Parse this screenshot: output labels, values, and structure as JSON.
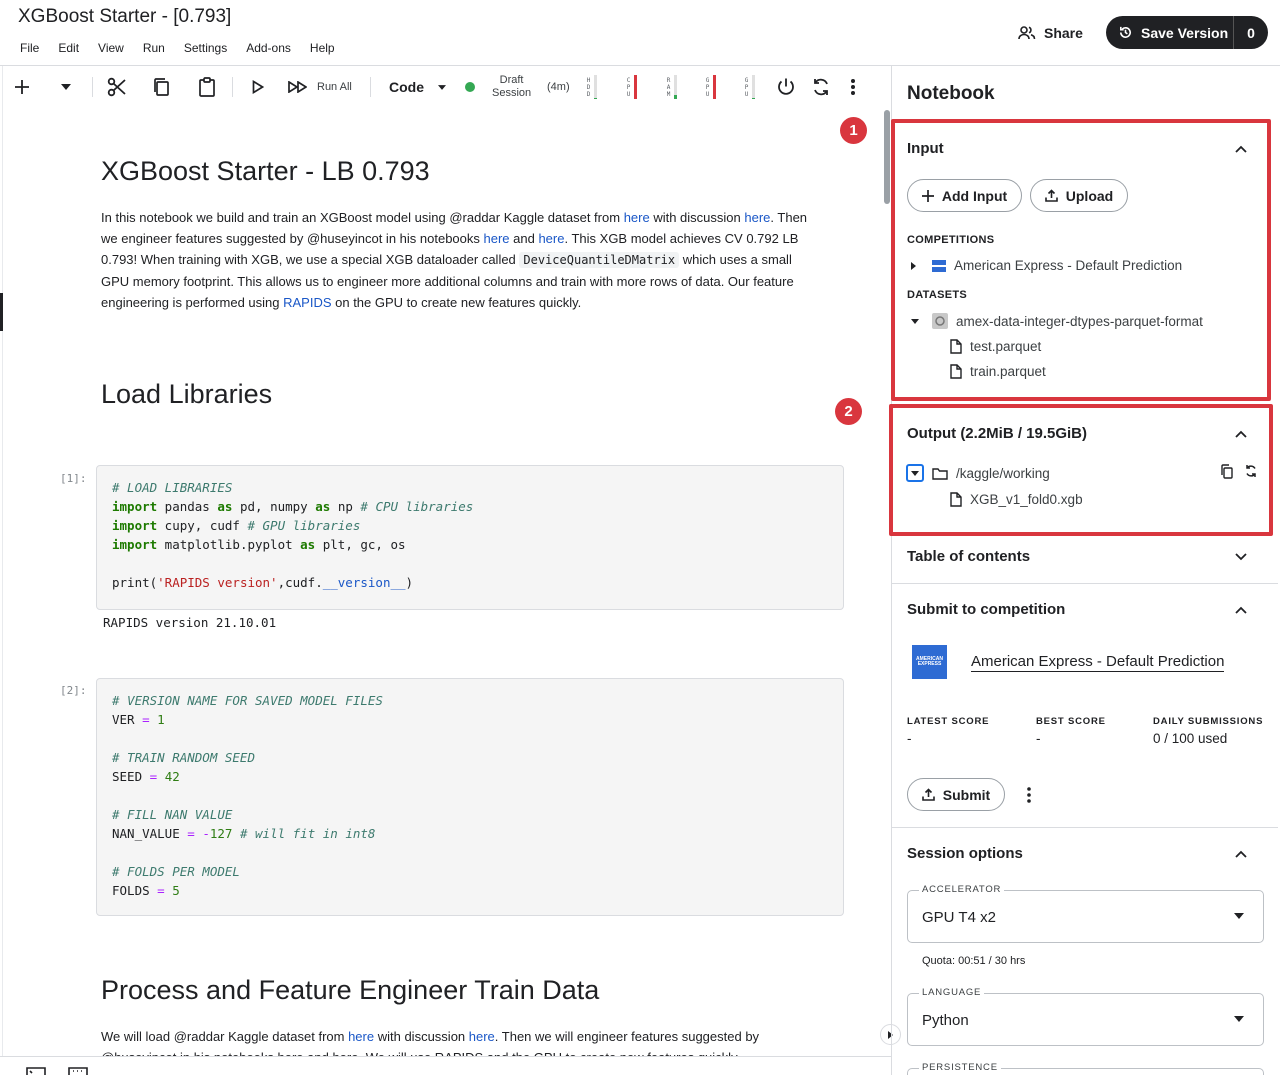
{
  "header": {
    "title": "XGBoost Starter - [0.793]",
    "menu": [
      "File",
      "Edit",
      "View",
      "Run",
      "Settings",
      "Add-ons",
      "Help"
    ],
    "share_label": "Share",
    "save_label": "Save Version",
    "save_count": "0"
  },
  "toolbar": {
    "run_all_label": "Run All",
    "cell_type": "Code",
    "session_line1": "Draft",
    "session_line2": "Session",
    "session_time": "(4m)",
    "session_status_color": "#34a853",
    "meters": [
      {
        "label": [
          "H",
          "D",
          "D"
        ],
        "fill": 0.05,
        "color": "#34a853"
      },
      {
        "label": [
          "C",
          "P",
          "U"
        ],
        "fill": 1.0,
        "color": "#d9363e"
      },
      {
        "label": [
          "R",
          "A",
          "M"
        ],
        "fill": 0.15,
        "color": "#34a853"
      },
      {
        "label": [
          "G",
          "P",
          "U"
        ],
        "fill": 1.0,
        "color": "#d9363e"
      },
      {
        "label": [
          "G",
          "P",
          "U"
        ],
        "fill": 0.05,
        "color": "#34a853"
      }
    ]
  },
  "notebook": {
    "h1_title": "XGBoost Starter - LB 0.793",
    "intro": {
      "t1": "In this notebook we build and train an XGBoost model using @raddar Kaggle dataset from ",
      "l1": "here",
      "t2": " with discussion ",
      "l2": "here",
      "t3": ". Then we engineer features suggested by @huseyincot in his notebooks ",
      "l3": "here",
      "t4": " and ",
      "l4": "here",
      "t5": ". This XGB model achieves CV 0.792 LB 0.793! When training with XGB, we use a special XGB dataloader called ",
      "code": "DeviceQuantileDMatrix",
      "t6": " which uses a small GPU memory footprint. This allows us to engineer more additional columns and train with more rows of data. Our feature engineering is performed using ",
      "l5": "RAPIDS",
      "t7": " on the GPU to create new features quickly."
    },
    "h1_load": "Load Libraries",
    "prompt1": "[1]:",
    "cell1": {
      "c1": "# LOAD LIBRARIES",
      "k1": "import",
      "m1": " pandas ",
      "k2": "as",
      "m2": " pd, numpy ",
      "k3": "as",
      "m3": " np ",
      "c2": "# CPU libraries",
      "k4": "import",
      "m4": " cupy, cudf ",
      "c3": "# GPU libraries",
      "k5": "import",
      "m5": " matplotlib.pyplot ",
      "k6": "as",
      "m6": " plt, gc, os",
      "p1": "print(",
      "s1": "'RAPIDS version'",
      "p2": ",cudf.",
      "a1": "__version__",
      "p3": ")"
    },
    "output1": "RAPIDS version 21.10.01",
    "prompt2": "[2]:",
    "cell2": {
      "c1": "# VERSION NAME FOR SAVED MODEL FILES",
      "v1": "VER ",
      "o1": "=",
      "n1": " 1",
      "c2": "# TRAIN RANDOM SEED",
      "v2": "SEED ",
      "o2": "=",
      "n2": " 42",
      "c3": "# FILL NAN VALUE",
      "v3": "NAN_VALUE ",
      "o3": "=",
      "n3a": " ",
      "o3b": "-",
      "n3": "127",
      "c4": " # will fit in int8",
      "c5": "# FOLDS PER MODEL",
      "v5": "FOLDS ",
      "o5": "=",
      "n5": " 5"
    },
    "h1_process": "Process and Feature Engineer Train Data",
    "process_text": {
      "t1": "We will load @raddar Kaggle dataset from ",
      "l1": "here",
      "t2": " with discussion ",
      "l2": "here",
      "t3": ". Then we will engineer features suggested by @huseyincot in his notebooks here and here. We will use RAPIDS and the GPU to create new features quickly."
    }
  },
  "panel": {
    "title": "Notebook",
    "badge1": "1",
    "badge2": "2",
    "input": {
      "title": "Input",
      "add_input": "Add Input",
      "upload": "Upload",
      "competitions_label": "COMPETITIONS",
      "competition": "American Express - Default Prediction",
      "datasets_label": "DATASETS",
      "dataset": "amex-data-integer-dtypes-parquet-format",
      "files": [
        "test.parquet",
        "train.parquet"
      ]
    },
    "output": {
      "title": "Output (2.2MiB / 19.5GiB)",
      "folder": "/kaggle/working",
      "file": "XGB_v1_fold0.xgb"
    },
    "toc": {
      "title": "Table of contents"
    },
    "submit": {
      "title": "Submit to competition",
      "logo_text": "AMERICAN EXPRESS",
      "competition": "American Express - Default Prediction",
      "latest_label": "LATEST SCORE",
      "latest_value": "-",
      "best_label": "BEST SCORE",
      "best_value": "-",
      "daily_label": "DAILY SUBMISSIONS",
      "daily_value": "0 / 100 used",
      "submit_label": "Submit"
    },
    "session": {
      "title": "Session options",
      "accelerator_label": "ACCELERATOR",
      "accelerator_value": "GPU T4 x2",
      "quota": "Quota: 00:51 / 30 hrs",
      "language_label": "LANGUAGE",
      "language_value": "Python",
      "persistence_label": "PERSISTENCE"
    }
  }
}
